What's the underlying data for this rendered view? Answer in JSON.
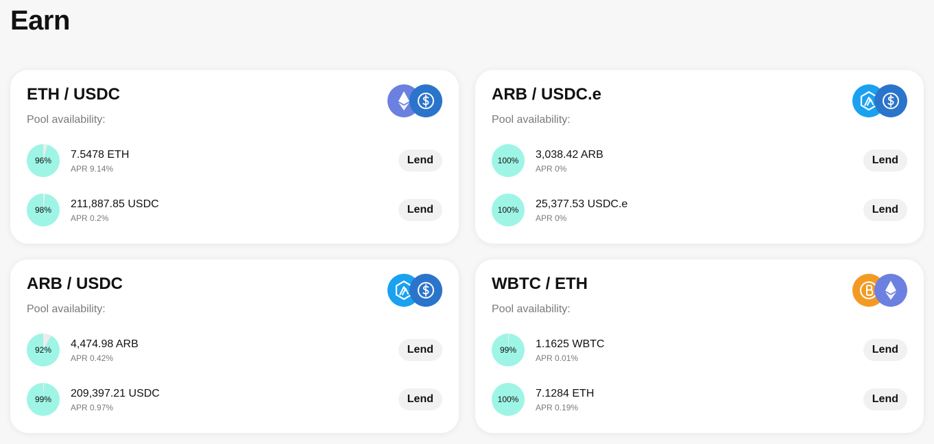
{
  "page": {
    "title": "Earn"
  },
  "colors": {
    "pie_fill": "#9ef5e6",
    "pie_empty": "#ececec",
    "lend_bg": "#f1f1f1",
    "eth": "#6b80e0",
    "usdc": "#2b74cb",
    "arb": "#1aa1ef",
    "btc": "#f39a25"
  },
  "pools": [
    {
      "title": "ETH / USDC",
      "subtitle": "Pool availability:",
      "icons": [
        "ethereum-icon",
        "usdc-icon"
      ],
      "assets": [
        {
          "availability_pct": 96,
          "availability_label": "96%",
          "amount": "7.5478 ETH",
          "apr": "APR 9.14%",
          "action": "Lend"
        },
        {
          "availability_pct": 98,
          "availability_label": "98%",
          "amount": "211,887.85 USDC",
          "apr": "APR 0.2%",
          "action": "Lend"
        }
      ]
    },
    {
      "title": "ARB / USDC.e",
      "subtitle": "Pool availability:",
      "icons": [
        "arbitrum-icon",
        "usdc-icon"
      ],
      "assets": [
        {
          "availability_pct": 100,
          "availability_label": "100%",
          "amount": "3,038.42 ARB",
          "apr": "APR 0%",
          "action": "Lend"
        },
        {
          "availability_pct": 100,
          "availability_label": "100%",
          "amount": "25,377.53 USDC.e",
          "apr": "APR 0%",
          "action": "Lend"
        }
      ]
    },
    {
      "title": "ARB / USDC",
      "subtitle": "Pool availability:",
      "icons": [
        "arbitrum-icon",
        "usdc-icon"
      ],
      "assets": [
        {
          "availability_pct": 92,
          "availability_label": "92%",
          "amount": "4,474.98 ARB",
          "apr": "APR 0.42%",
          "action": "Lend"
        },
        {
          "availability_pct": 99,
          "availability_label": "99%",
          "amount": "209,397.21 USDC",
          "apr": "APR 0.97%",
          "action": "Lend"
        }
      ]
    },
    {
      "title": "WBTC / ETH",
      "subtitle": "Pool availability:",
      "icons": [
        "bitcoin-icon",
        "ethereum-icon"
      ],
      "assets": [
        {
          "availability_pct": 99,
          "availability_label": "99%",
          "amount": "1.1625 WBTC",
          "apr": "APR 0.01%",
          "action": "Lend"
        },
        {
          "availability_pct": 100,
          "availability_label": "100%",
          "amount": "7.1284 ETH",
          "apr": "APR 0.19%",
          "action": "Lend"
        }
      ]
    }
  ]
}
